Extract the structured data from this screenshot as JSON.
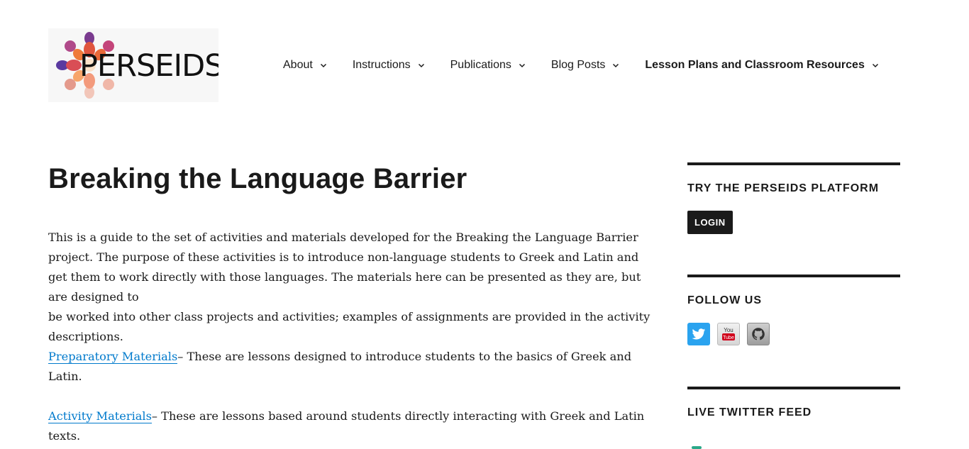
{
  "header": {
    "logo_text": "PERSEIDS",
    "nav": [
      {
        "label": "About"
      },
      {
        "label": "Instructions"
      },
      {
        "label": "Publications"
      },
      {
        "label": "Blog Posts"
      },
      {
        "label": "Lesson Plans and Classroom Resources"
      }
    ]
  },
  "main": {
    "title": "Breaking the Language Barrier",
    "intro_line1": "This is a guide to the set of activities and materials developed for the Breaking the Language Barrier project. The purpose of these activities is to introduce non-language students to Greek and Latin and get them to work directly with those languages. The materials here can be presented as they are, but are designed to",
    "intro_line2": "be worked into other class projects and activities; examples of assignments are provided in the activity descriptions.",
    "prep_link": "Preparatory Materials",
    "prep_text": "– These are lessons designed to introduce students to the basics of Greek and Latin.",
    "activity_link": "Activity Materials",
    "activity_text": "– These are lessons based around students directly interacting with Greek and Latin texts."
  },
  "sidebar": {
    "platform_heading": "TRY THE PERSEIDS PLATFORM",
    "login_label": "LOGIN",
    "follow_heading": "FOLLOW US",
    "social": [
      {
        "icon": "twitter-icon"
      },
      {
        "icon": "youtube-icon",
        "text": "You Tube"
      },
      {
        "icon": "github-icon"
      }
    ],
    "feed_heading": "LIVE TWITTER FEED"
  },
  "colors": {
    "link": "#007acc",
    "text": "#1a1a1a",
    "twitter": "#2aa3ef"
  }
}
